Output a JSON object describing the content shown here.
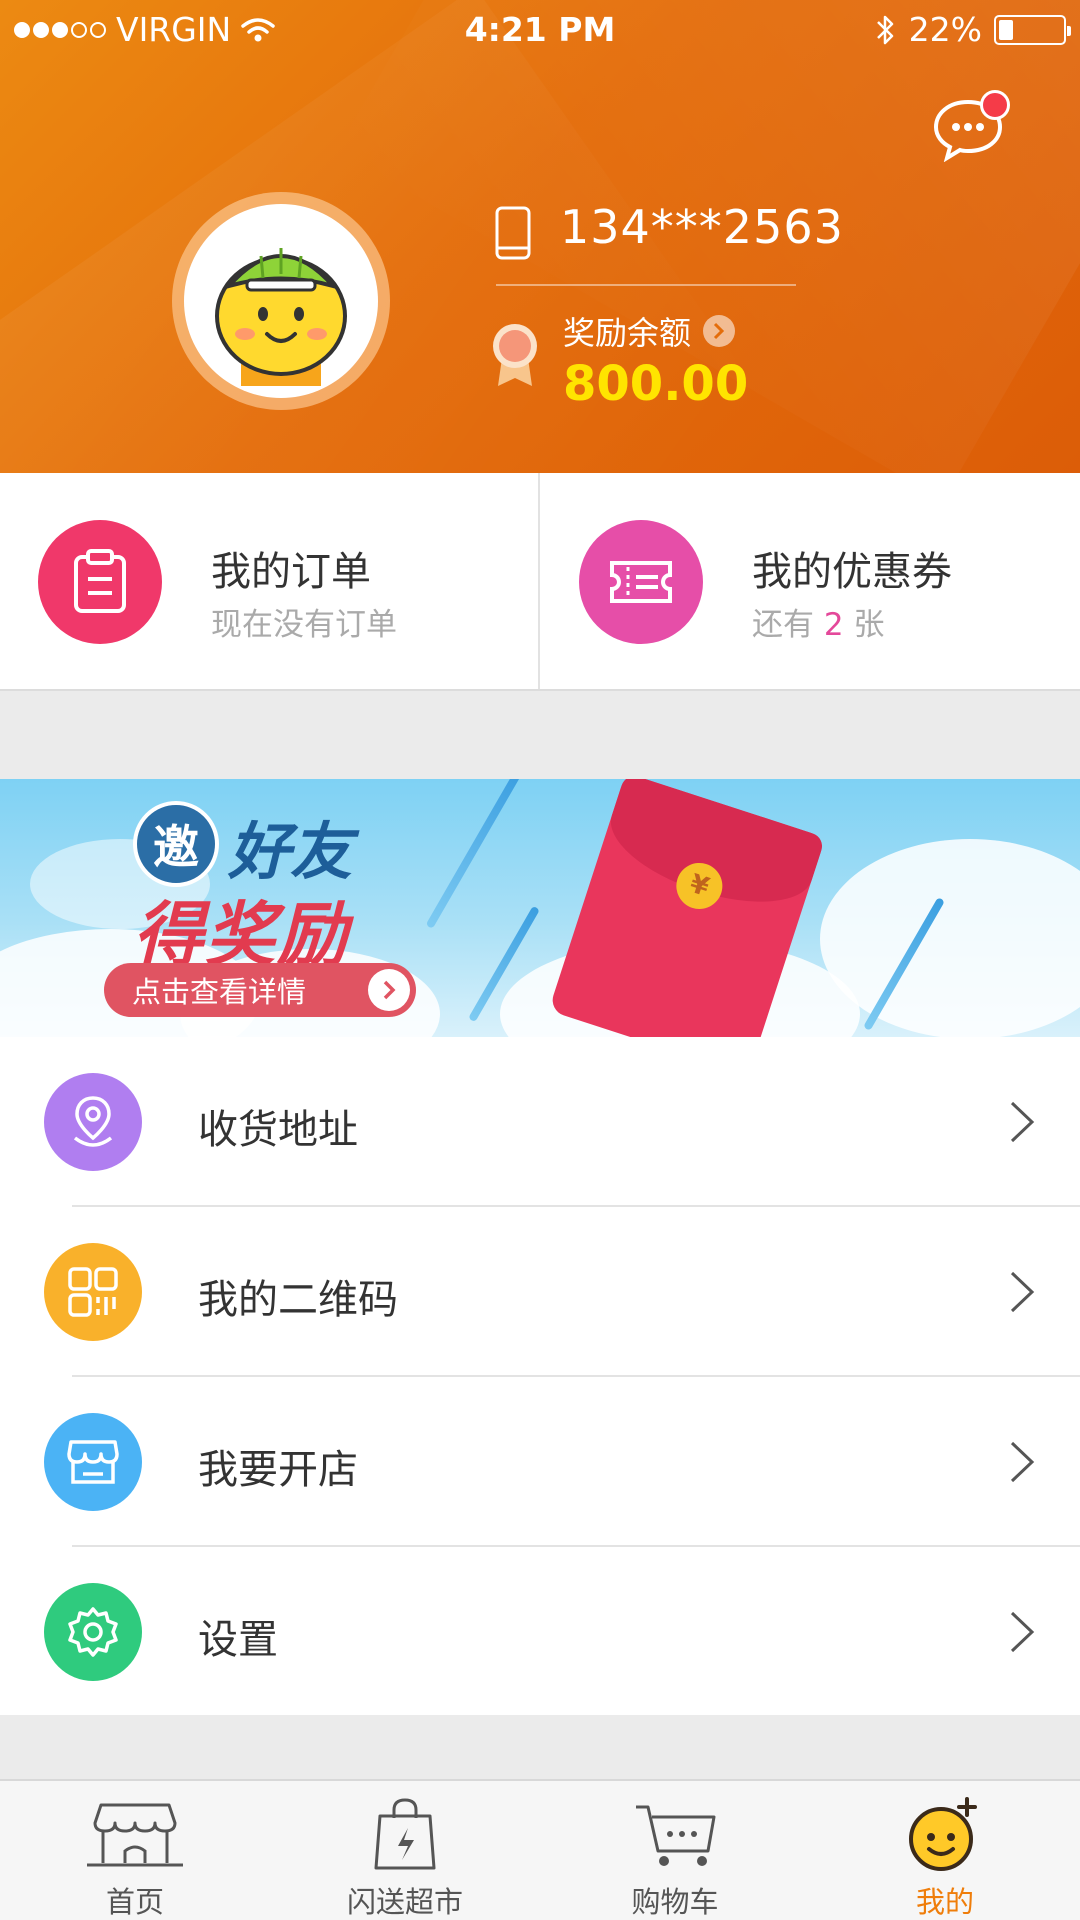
{
  "status_bar": {
    "carrier": "VIRGIN",
    "time": "4:21 PM",
    "battery_percent": "22%",
    "battery_level": 0.22
  },
  "header": {
    "phone": "134***2563",
    "reward_label": "奖励余额",
    "reward_amount": "800.00",
    "message_icon": "chat-bubble-icon",
    "has_unread": true
  },
  "cards": {
    "orders": {
      "title": "我的订单",
      "subtitle": "现在没有订单",
      "icon": "clipboard-icon",
      "color": "#f0386a"
    },
    "coupons": {
      "title": "我的优惠券",
      "subtitle_prefix": "还有",
      "count": "2",
      "subtitle_suffix": "张",
      "icon": "ticket-icon",
      "color": "#e64ea8"
    }
  },
  "banner": {
    "badge": "邀",
    "line1": "好友",
    "line2": "得奖励",
    "cta": "点击查看详情"
  },
  "menu": {
    "items": [
      {
        "label": "收货地址",
        "icon": "location-pin-icon",
        "color": "#b07ef0"
      },
      {
        "label": "我的二维码",
        "icon": "qr-code-icon",
        "color": "#f9b12b"
      },
      {
        "label": "我要开店",
        "icon": "store-icon",
        "color": "#4bb3f5"
      },
      {
        "label": "设置",
        "icon": "gear-icon",
        "color": "#2fcb7e"
      }
    ]
  },
  "tabbar": {
    "tabs": [
      {
        "label": "首页",
        "icon": "home-store-icon"
      },
      {
        "label": "闪送超市",
        "icon": "shopping-bag-icon"
      },
      {
        "label": "购物车",
        "icon": "cart-icon"
      },
      {
        "label": "我的",
        "icon": "profile-face-icon",
        "active": true
      }
    ]
  },
  "colors": {
    "header": "#e46d0b",
    "accent": "#ef7d0a",
    "reward": "#ffe400"
  }
}
